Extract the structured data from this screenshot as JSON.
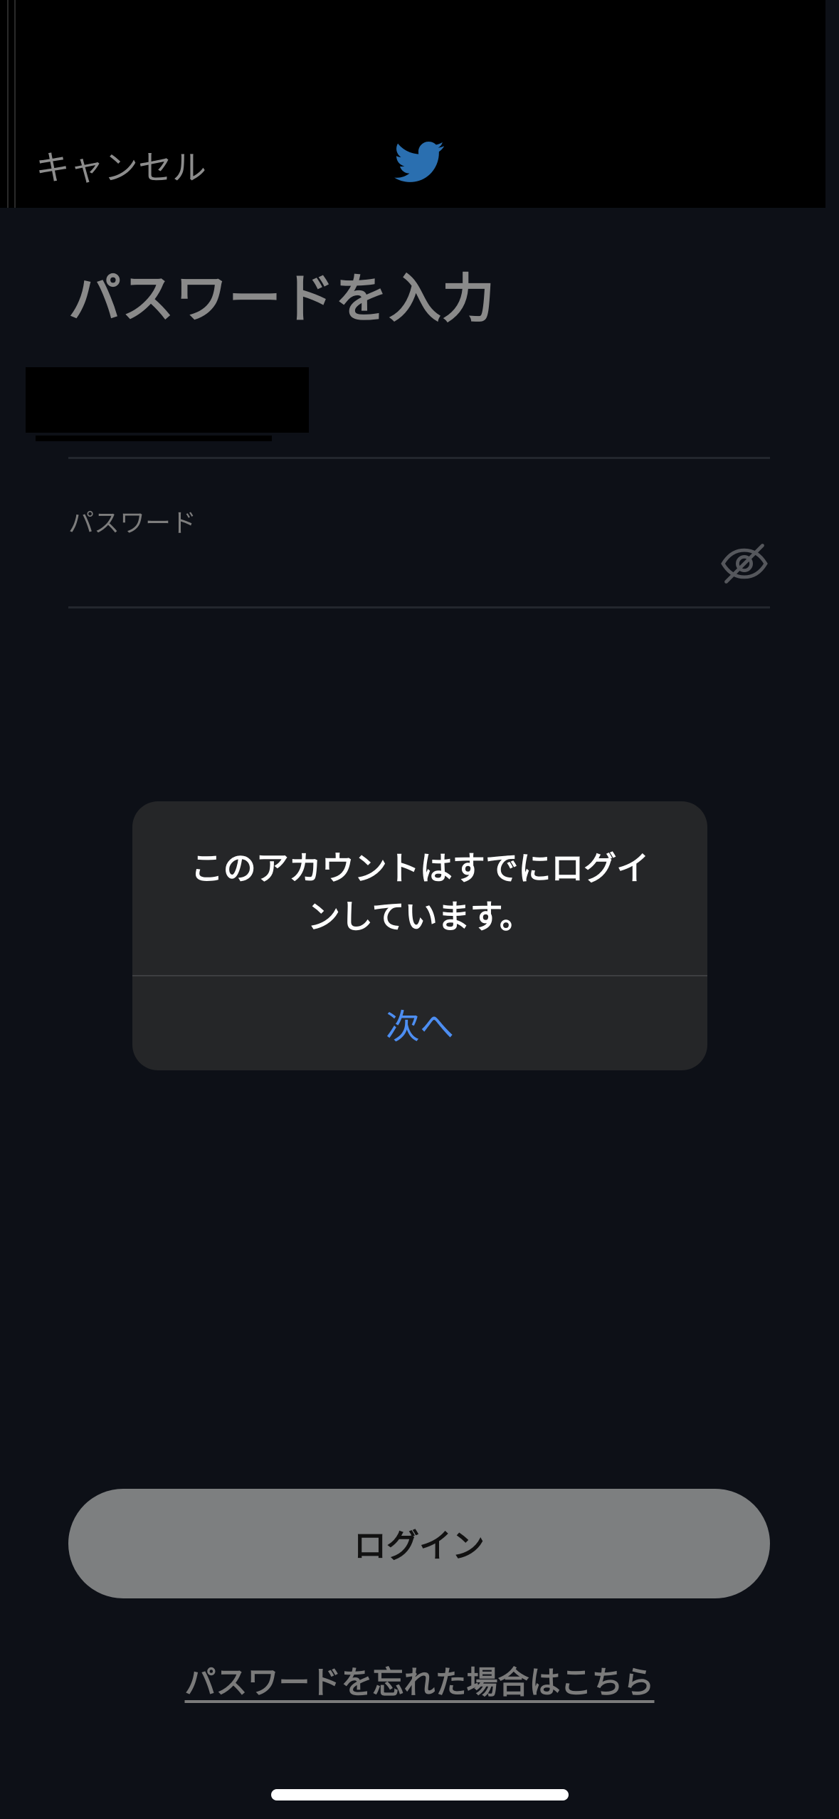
{
  "header": {
    "cancel_label": "キャンセル",
    "logo_icon": "twitter-bird-icon",
    "logo_color": "#2a6fb0"
  },
  "form": {
    "title": "パスワードを入力",
    "password_label": "パスワード",
    "visibility_icon": "eye-slash-icon"
  },
  "alert": {
    "message": "このアカウントはすでにログインしています。",
    "next_label": "次へ",
    "button_color": "#4d8ef2"
  },
  "footer": {
    "login_label": "ログイン",
    "forgot_label": "パスワードを忘れた場合はこちら"
  }
}
